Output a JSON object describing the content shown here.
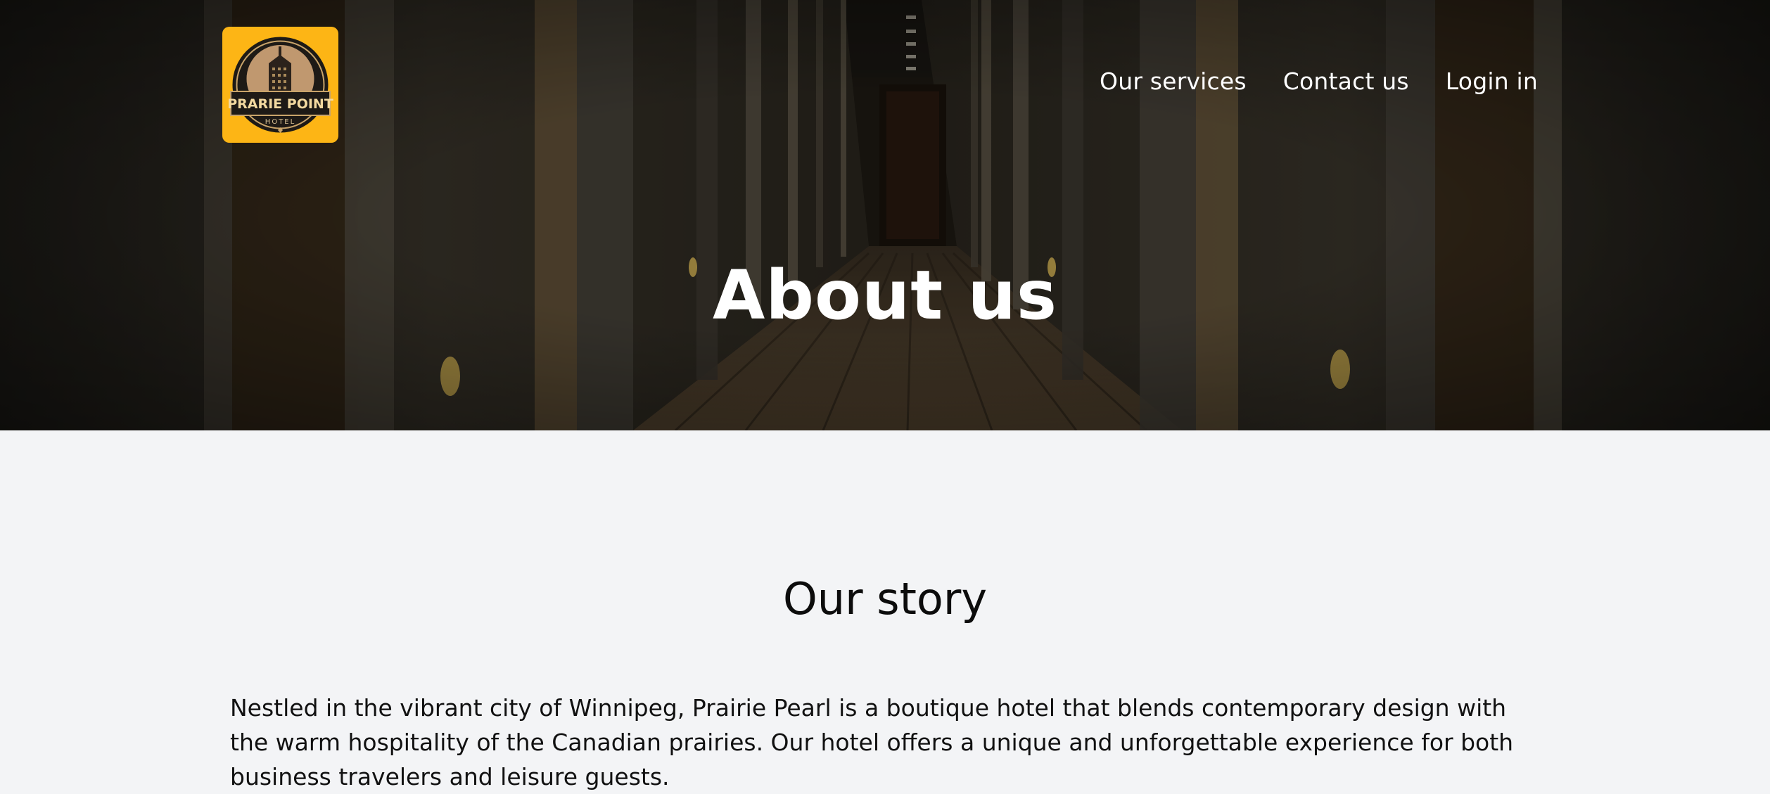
{
  "brand": {
    "name": "PRARIE POINT",
    "subname": "HOTEL",
    "logo_bg": "#fdb515"
  },
  "nav": {
    "items": [
      {
        "label": "Our services"
      },
      {
        "label": "Contact us"
      },
      {
        "label": "Login in"
      }
    ]
  },
  "hero": {
    "title": "About us"
  },
  "story": {
    "title": "Our story",
    "text": "Nestled in the vibrant city of Winnipeg, Prairie Pearl is a boutique hotel that blends contemporary design with the warm hospitality of the Canadian prairies. Our hotel offers a unique and unforgettable experience for both business travelers and leisure guests."
  },
  "colors": {
    "page_bg": "#f3f4f6",
    "hero_text": "#ffffff",
    "body_text": "#111111",
    "accent": "#fdb515"
  }
}
